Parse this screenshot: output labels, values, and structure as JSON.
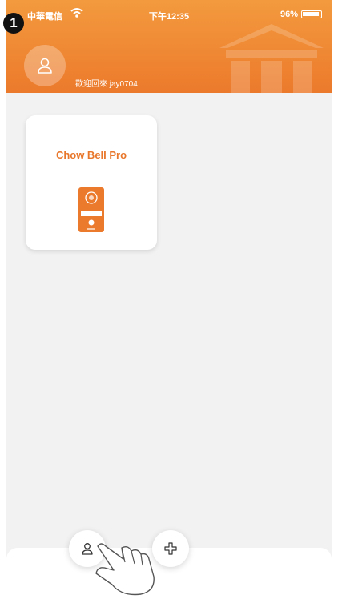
{
  "step_badge": "1",
  "status_bar": {
    "carrier": "中華電信",
    "time": "下午12:35",
    "battery": "96%",
    "battery_level": 0.96
  },
  "header": {
    "welcome_text": "歡迎回來 jay0704"
  },
  "devices": [
    {
      "name": "Chow Bell Pro"
    }
  ],
  "bottom_bar": {
    "buttons": [
      "user-icon",
      "add-icon"
    ]
  },
  "colors": {
    "accent": "#ec7a2c",
    "background": "#f2f2f2"
  }
}
